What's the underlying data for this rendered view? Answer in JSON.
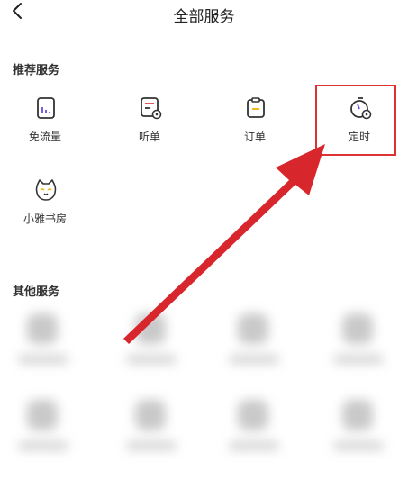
{
  "header": {
    "title": "全部服务",
    "back_icon": "chevron-left-icon"
  },
  "recommended": {
    "title": "推荐服务",
    "items": [
      {
        "label": "免流量",
        "icon": "data-plan-icon"
      },
      {
        "label": "听单",
        "icon": "listen-list-icon"
      },
      {
        "label": "订单",
        "icon": "order-icon"
      },
      {
        "label": "定时",
        "icon": "timer-icon"
      },
      {
        "label": "小雅书房",
        "icon": "cat-mascot-icon"
      }
    ]
  },
  "other": {
    "title": "其他服务"
  },
  "colors": {
    "accent_purple": "#6a4fe0",
    "accent_red": "#e8424d",
    "accent_yellow": "#f2b820",
    "annotation_red": "#d8262d"
  }
}
